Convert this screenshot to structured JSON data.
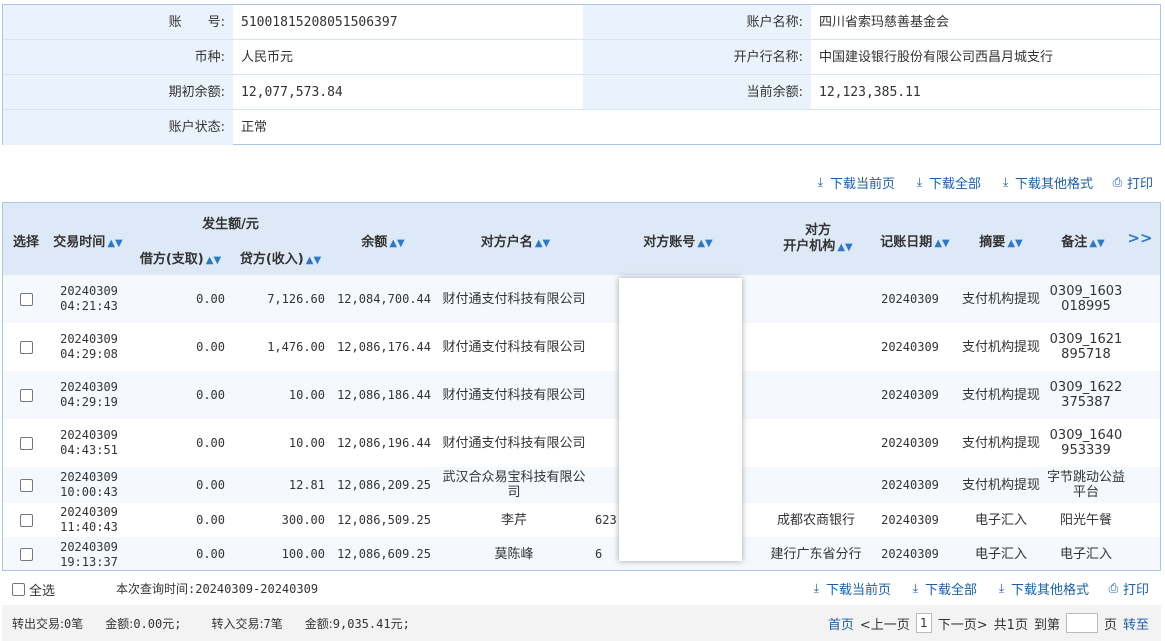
{
  "account": {
    "acct_no_label": "账　　号:",
    "acct_no": "51001815208051506397",
    "acct_name_label": "账户名称:",
    "acct_name": "四川省索玛慈善基金会",
    "currency_label": "币种:",
    "currency": "人民币元",
    "bank_label": "开户行名称:",
    "bank": "中国建设银行股份有限公司西昌月城支行",
    "opening_label": "期初余额:",
    "opening": "12,077,573.84",
    "current_label": "当前余额:",
    "current": "12,123,385.11",
    "status_label": "账户状态:",
    "status": "正常"
  },
  "toolbar": {
    "download_page": "下载当前页",
    "download_all": "下载全部",
    "download_other": "下载其他格式",
    "print": "打印"
  },
  "table": {
    "headers": {
      "select": "选择",
      "time": "交易时间",
      "amount_group": "发生额/元",
      "debit": "借方(支取)",
      "credit": "贷方(收入)",
      "balance": "余额",
      "cp_name": "对方户名",
      "cp_account": "对方账号",
      "cp_bank_line1": "对方",
      "cp_bank_line2": "开户机构",
      "book_date": "记账日期",
      "summary": "摘要",
      "remark": "备注",
      "more": ">>"
    },
    "rows": [
      {
        "date": "20240309",
        "time": "04:21:43",
        "debit": "0.00",
        "credit": "7,126.60",
        "balance": "12,084,700.44",
        "cp_name": "财付通支付科技有限公司",
        "cp_account": "",
        "cp_bank": "",
        "book_date": "20240309",
        "summary": "支付机构提现",
        "remark": "0309_1603018995"
      },
      {
        "date": "20240309",
        "time": "04:29:08",
        "debit": "0.00",
        "credit": "1,476.00",
        "balance": "12,086,176.44",
        "cp_name": "财付通支付科技有限公司",
        "cp_account": "",
        "cp_bank": "",
        "book_date": "20240309",
        "summary": "支付机构提现",
        "remark": "0309_1621895718"
      },
      {
        "date": "20240309",
        "time": "04:29:19",
        "debit": "0.00",
        "credit": "10.00",
        "balance": "12,086,186.44",
        "cp_name": "财付通支付科技有限公司",
        "cp_account": "",
        "cp_bank": "",
        "book_date": "20240309",
        "summary": "支付机构提现",
        "remark": "0309_1622375387"
      },
      {
        "date": "20240309",
        "time": "04:43:51",
        "debit": "0.00",
        "credit": "10.00",
        "balance": "12,086,196.44",
        "cp_name": "财付通支付科技有限公司",
        "cp_account": "",
        "cp_bank": "",
        "book_date": "20240309",
        "summary": "支付机构提现",
        "remark": "0309_1640953339"
      },
      {
        "date": "20240309",
        "time": "10:00:43",
        "debit": "0.00",
        "credit": "12.81",
        "balance": "12,086,209.25",
        "cp_name": "武汉合众易宝科技有限公司",
        "cp_account": "",
        "cp_bank": "",
        "book_date": "20240309",
        "summary": "支付机构提现",
        "remark": "字节跳动公益平台"
      },
      {
        "date": "20240309",
        "time": "11:40:43",
        "debit": "0.00",
        "credit": "300.00",
        "balance": "12,086,509.25",
        "cp_name": "李芹",
        "cp_account": "623",
        "cp_bank": "成都农商银行",
        "book_date": "20240309",
        "summary": "电子汇入",
        "remark": "阳光午餐"
      },
      {
        "date": "20240309",
        "time": "19:13:37",
        "debit": "0.00",
        "credit": "100.00",
        "balance": "12,086,609.25",
        "cp_name": "莫陈峰",
        "cp_account": "6",
        "cp_bank": "建行广东省分行",
        "book_date": "20240309",
        "summary": "电子汇入",
        "remark": "电子汇入"
      }
    ]
  },
  "footer": {
    "select_all": "全选",
    "query_time": "本次查询时间:20240309-20240309",
    "out_label": "转出交易:",
    "out_count": "0笔",
    "out_amount_label": "金额:",
    "out_amount": "0.00元;",
    "in_label": "转入交易:",
    "in_count": "7笔",
    "in_amount_label": "金额:",
    "in_amount": "9,035.41元;",
    "first": "首页",
    "prev": "<上一页",
    "page": "1",
    "next": "下一页>",
    "total": "共1页",
    "goto": "到第",
    "page_unit": "页",
    "go": "转至"
  }
}
